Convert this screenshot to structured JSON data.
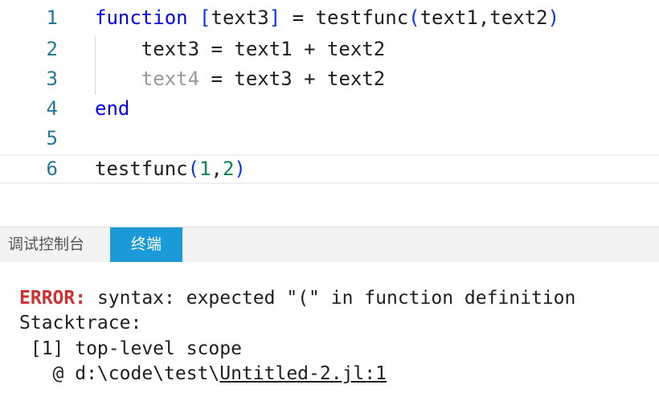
{
  "editor": {
    "lines": [
      {
        "num": "1",
        "k1": "function",
        "t1": " ",
        "b1": "[",
        "t2": "text3",
        "b2": "]",
        "t3": " = testfunc",
        "b3": "(",
        "t4": "text1,text2",
        "b4": ")"
      },
      {
        "num": "2",
        "text": "    text3 = text1 + text2"
      },
      {
        "num": "3",
        "dim": "    text4",
        "rest": " = text3 + text2"
      },
      {
        "num": "4",
        "kw": "end"
      },
      {
        "num": "5"
      },
      {
        "num": "6",
        "fn": "testfunc",
        "p1": "(",
        "n1": "1",
        "comma": ",",
        "n2": "2",
        "p2": ")"
      }
    ]
  },
  "panel": {
    "tabs": {
      "debug_console": "调试控制台",
      "terminal": "终端"
    },
    "active_tab": "terminal",
    "accent_color": "#1a9bd7"
  },
  "terminal": {
    "error_label": "ERROR:",
    "error_message": " syntax: expected \"(\" in function definition",
    "stacktrace": "Stacktrace:",
    "frame1": " [1] top-level scope",
    "frame_at": "   @ d:\\code\\test\\",
    "frame_file": "Untitled-2.jl:1"
  }
}
